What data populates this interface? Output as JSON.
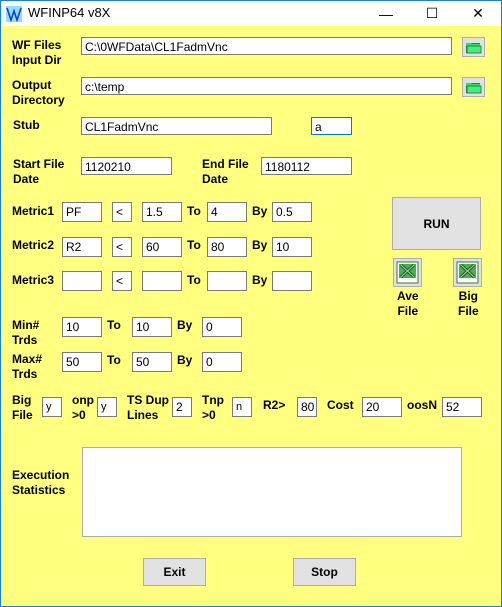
{
  "window": {
    "title": "WFINP64 v8X",
    "controls": {
      "minimize": "—",
      "maximize": "☐",
      "close": "✕"
    }
  },
  "colors": {
    "background": "#ffff80",
    "border": "#1c7fd4",
    "folder_icon": "#33dd66",
    "excel_icon": "#2e7d32"
  },
  "paths": {
    "input_dir_label_1": "WF Files",
    "input_dir_label_2": "Input Dir",
    "input_dir_value": "C:\\0WFData\\CL1FadmVnc",
    "output_dir_label_1": "Output",
    "output_dir_label_2": "Directory",
    "output_dir_value": "c:\\temp"
  },
  "stub": {
    "label": "Stub",
    "value": "CL1FadmVnc",
    "suffix_value": "a"
  },
  "dates": {
    "start_label_1": "Start File",
    "start_label_2": "Date",
    "start_value": "1120210",
    "end_label_1": "End File",
    "end_label_2": "Date",
    "end_value": "1180112"
  },
  "metrics": [
    {
      "label": "Metric1",
      "name": "PF",
      "op": "<",
      "from": "1.5",
      "to_label": "To",
      "to": "4",
      "by_label": "By",
      "by": "0.5"
    },
    {
      "label": "Metric2",
      "name": "R2",
      "op": "<",
      "from": "60",
      "to_label": "To",
      "to": "80",
      "by_label": "By",
      "by": "10"
    },
    {
      "label": "Metric3",
      "name": "",
      "op": "<",
      "from": "",
      "to_label": "To",
      "to": "",
      "by_label": "By",
      "by": ""
    }
  ],
  "trades": {
    "min_label_1": "Min#",
    "min_label_2": "Trds",
    "min_from": "10",
    "min_to": "10",
    "min_by": "0",
    "max_label_1": "Max#",
    "max_label_2": "Trds",
    "max_from": "50",
    "max_to": "50",
    "max_by": "0",
    "to_label": "To",
    "by_label": "By"
  },
  "options": {
    "big_file_label_1": "Big",
    "big_file_label_2": "File",
    "big_file": "y",
    "onp_label_1": "onp",
    "onp_label_2": ">0",
    "onp": "y",
    "ts_dup_label_1": "TS Dup",
    "ts_dup_label_2": "Lines",
    "ts_dup": "2",
    "tnp_label_1": "Tnp",
    "tnp_label_2": ">0",
    "tnp": "n",
    "r2_label": "R2>",
    "r2": "80",
    "cost_label": "Cost",
    "cost": "20",
    "oosn_label": "oosN",
    "oosn": "52"
  },
  "actions": {
    "run_label": "RUN",
    "ave_file_label_1": "Ave",
    "ave_file_label_2": "File",
    "big_file_label_1": "Big",
    "big_file_label_2": "File",
    "exit_label": "Exit",
    "stop_label": "Stop"
  },
  "execution": {
    "label_1": "Execution",
    "label_2": "Statistics",
    "value": ""
  }
}
